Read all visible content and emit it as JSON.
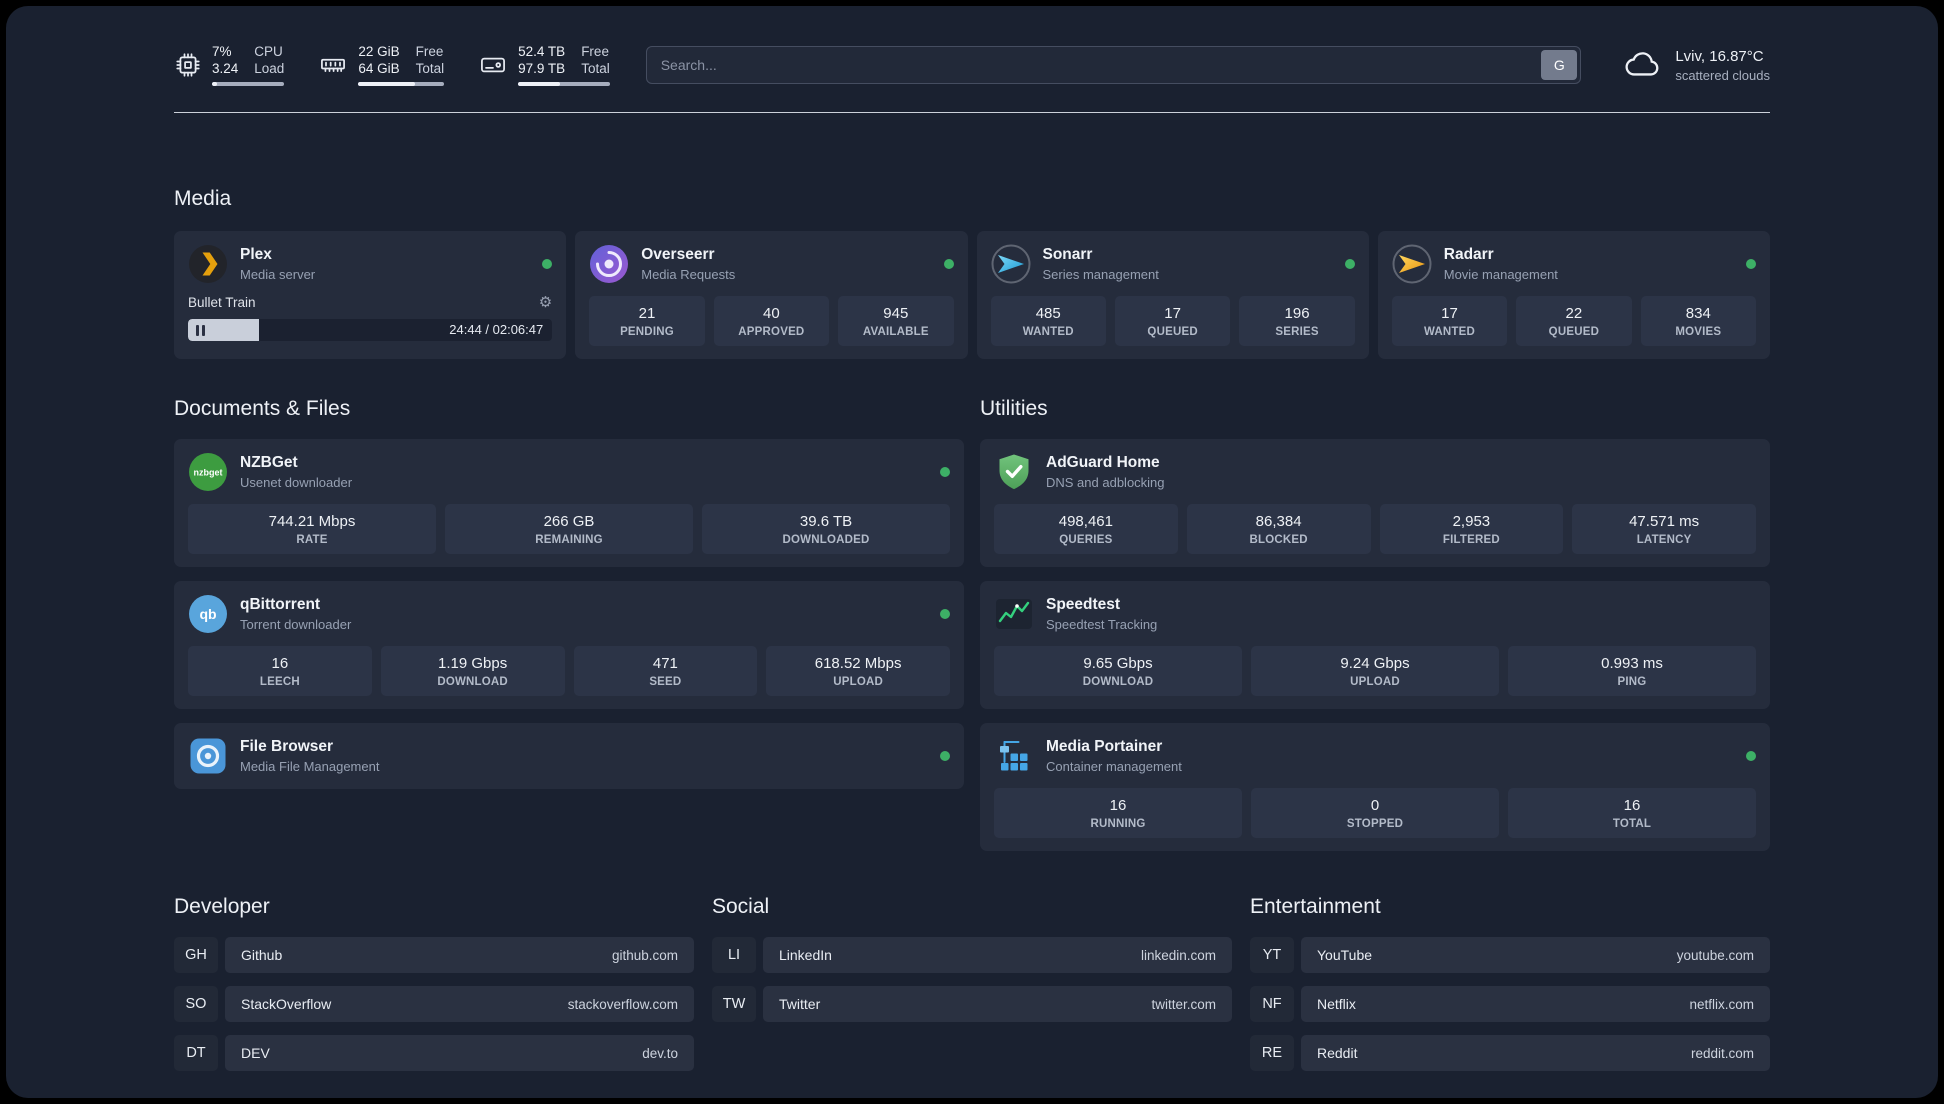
{
  "colors": {
    "status_green": "#3db066",
    "plex_amber": "#e5a00d",
    "page_bg": "#1a2130",
    "card_bg": "#252c3c"
  },
  "header": {
    "cpu": {
      "value1": "7%",
      "label1": "CPU",
      "value2": "3.24",
      "label2": "Load",
      "bar_percent": 7
    },
    "ram": {
      "value1": "22 GiB",
      "label1": "Free",
      "value2": "64 GiB",
      "label2": "Total",
      "bar_percent": 66
    },
    "disk": {
      "value1": "52.4 TB",
      "label1": "Free",
      "value2": "97.9 TB",
      "label2": "Total",
      "bar_percent": 46
    },
    "search": {
      "placeholder": "Search...",
      "button_label": "G"
    },
    "weather": {
      "location": "Lviv, 16.87°C",
      "condition": "scattered clouds"
    }
  },
  "sections": {
    "media": {
      "title": "Media",
      "plex": {
        "name": "Plex",
        "subtitle": "Media server",
        "now_playing": "Bullet Train",
        "time": "24:44 / 02:06:47",
        "progress_percent": 19.5
      },
      "overseerr": {
        "name": "Overseerr",
        "subtitle": "Media Requests",
        "stats": [
          {
            "value": "21",
            "label": "PENDING"
          },
          {
            "value": "40",
            "label": "APPROVED"
          },
          {
            "value": "945",
            "label": "AVAILABLE"
          }
        ]
      },
      "sonarr": {
        "name": "Sonarr",
        "subtitle": "Series management",
        "stats": [
          {
            "value": "485",
            "label": "WANTED"
          },
          {
            "value": "17",
            "label": "QUEUED"
          },
          {
            "value": "196",
            "label": "SERIES"
          }
        ]
      },
      "radarr": {
        "name": "Radarr",
        "subtitle": "Movie management",
        "stats": [
          {
            "value": "17",
            "label": "WANTED"
          },
          {
            "value": "22",
            "label": "QUEUED"
          },
          {
            "value": "834",
            "label": "MOVIES"
          }
        ]
      }
    },
    "documents": {
      "title": "Documents & Files",
      "nzbget": {
        "name": "NZBGet",
        "subtitle": "Usenet downloader",
        "icon_text": "nzbget",
        "stats": [
          {
            "value": "744.21 Mbps",
            "label": "RATE"
          },
          {
            "value": "266 GB",
            "label": "REMAINING"
          },
          {
            "value": "39.6 TB",
            "label": "DOWNLOADED"
          }
        ]
      },
      "qbittorrent": {
        "name": "qBittorrent",
        "subtitle": "Torrent downloader",
        "icon_text": "qb",
        "stats": [
          {
            "value": "16",
            "label": "LEECH"
          },
          {
            "value": "1.19 Gbps",
            "label": "DOWNLOAD"
          },
          {
            "value": "471",
            "label": "SEED"
          },
          {
            "value": "618.52 Mbps",
            "label": "UPLOAD"
          }
        ]
      },
      "filebrowser": {
        "name": "File Browser",
        "subtitle": "Media File Management"
      }
    },
    "utilities": {
      "title": "Utilities",
      "adguard": {
        "name": "AdGuard Home",
        "subtitle": "DNS and adblocking",
        "stats": [
          {
            "value": "498,461",
            "label": "QUERIES"
          },
          {
            "value": "86,384",
            "label": "BLOCKED"
          },
          {
            "value": "2,953",
            "label": "FILTERED"
          },
          {
            "value": "47.571 ms",
            "label": "LATENCY"
          }
        ]
      },
      "speedtest": {
        "name": "Speedtest",
        "subtitle": "Speedtest Tracking",
        "stats": [
          {
            "value": "9.65 Gbps",
            "label": "DOWNLOAD"
          },
          {
            "value": "9.24 Gbps",
            "label": "UPLOAD"
          },
          {
            "value": "0.993 ms",
            "label": "PING"
          }
        ]
      },
      "portainer": {
        "name": "Media Portainer",
        "subtitle": "Container management",
        "stats": [
          {
            "value": "16",
            "label": "RUNNING"
          },
          {
            "value": "0",
            "label": "STOPPED"
          },
          {
            "value": "16",
            "label": "TOTAL"
          }
        ]
      }
    },
    "bookmarks": [
      {
        "title": "Developer",
        "links": [
          {
            "abbr": "GH",
            "name": "Github",
            "url": "github.com"
          },
          {
            "abbr": "SO",
            "name": "StackOverflow",
            "url": "stackoverflow.com"
          },
          {
            "abbr": "DT",
            "name": "DEV",
            "url": "dev.to"
          }
        ]
      },
      {
        "title": "Social",
        "links": [
          {
            "abbr": "LI",
            "name": "LinkedIn",
            "url": "linkedin.com"
          },
          {
            "abbr": "TW",
            "name": "Twitter",
            "url": "twitter.com"
          }
        ]
      },
      {
        "title": "Entertainment",
        "links": [
          {
            "abbr": "YT",
            "name": "YouTube",
            "url": "youtube.com"
          },
          {
            "abbr": "NF",
            "name": "Netflix",
            "url": "netflix.com"
          },
          {
            "abbr": "RE",
            "name": "Reddit",
            "url": "reddit.com"
          }
        ]
      }
    ]
  }
}
